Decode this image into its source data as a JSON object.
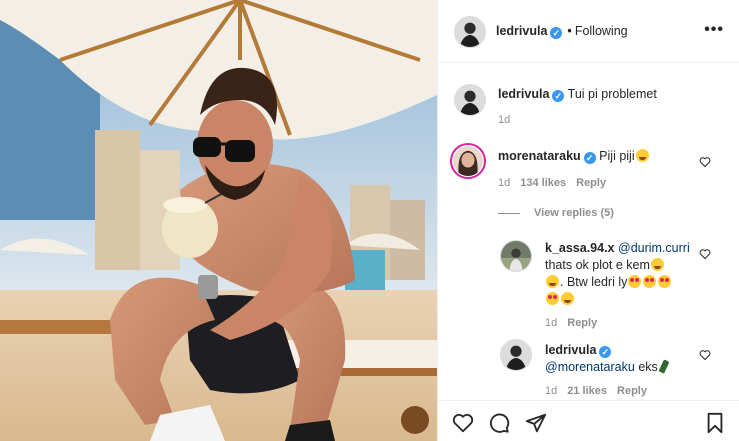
{
  "post": {
    "author": "ledrivula",
    "follow_status": "Following",
    "more_label": "•••"
  },
  "caption": {
    "username": "ledrivula",
    "text": "Tui pi problemet",
    "time": "1d"
  },
  "comments": [
    {
      "username": "morenataraku",
      "text": "Piji piji",
      "emoji": "laughing-face",
      "time": "1d",
      "likes": "134 likes",
      "reply": "Reply",
      "view_replies": "View replies (5)"
    },
    {
      "username": "k_assa.94.x",
      "mention": "@durim.curri",
      "text_line1": "thats ok plot e kem",
      "text_line2": ". Btw ledri ly",
      "emojis": [
        "laughing-face",
        "heart-eyes-face",
        "heart-eyes-face",
        "heart-eyes-face",
        "heart-eyes-face",
        "laughing-face"
      ],
      "time": "1d",
      "reply": "Reply"
    },
    {
      "username": "ledrivula",
      "mention": "@morenataraku",
      "text": "eks",
      "emoji": "champagne-bottle",
      "time": "1d",
      "likes": "21 likes",
      "reply": "Reply"
    }
  ],
  "icons": {
    "like": "heart-icon",
    "comment": "comment-icon",
    "share": "share-icon",
    "save": "bookmark-icon"
  },
  "colors": {
    "verified": "#3897f0",
    "story_ring": "#d6249f",
    "meta_gray": "#8e8e8e",
    "mention": "#00376b"
  }
}
